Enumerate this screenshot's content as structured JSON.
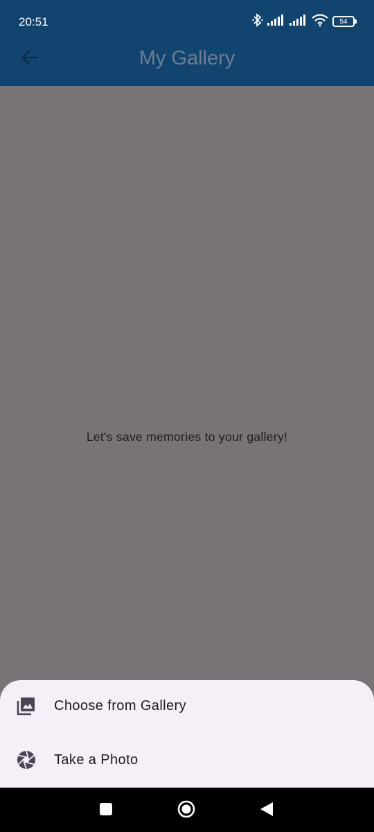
{
  "status_bar": {
    "time": "20:51",
    "battery_level": "54",
    "icons": [
      "bluetooth-icon",
      "signal-icon",
      "signal-icon",
      "wifi-icon",
      "battery-icon"
    ]
  },
  "app_bar": {
    "title": "My Gallery",
    "back_icon": "arrow-back-icon",
    "background_color": "#11446f"
  },
  "content": {
    "empty_message": "Let's save memories to your gallery!"
  },
  "bottom_sheet": {
    "items": [
      {
        "label": "Choose from Gallery",
        "icon": "photo-library-icon"
      },
      {
        "label": "Take a Photo",
        "icon": "camera-shutter-icon"
      }
    ],
    "background_color": "#f5eff7"
  },
  "nav_bar": {
    "buttons": [
      "recents-square-icon",
      "home-circle-icon",
      "back-triangle-icon"
    ]
  }
}
